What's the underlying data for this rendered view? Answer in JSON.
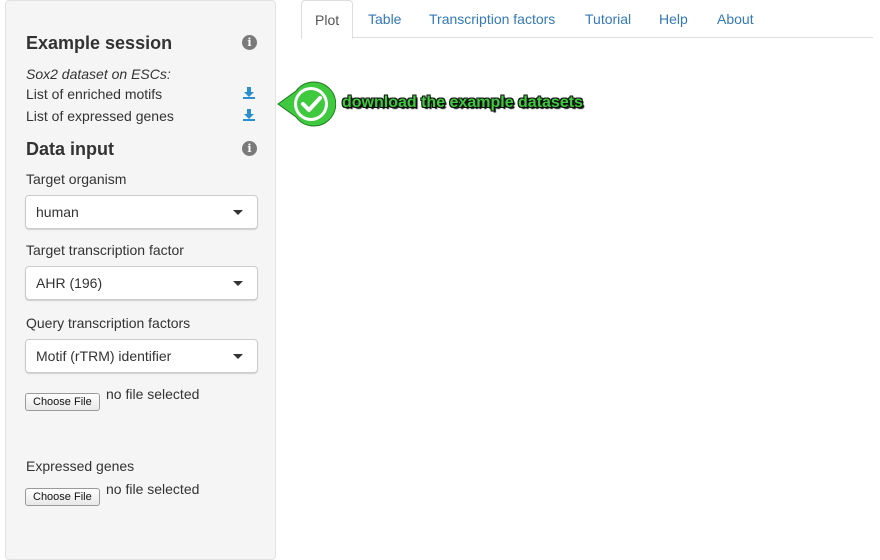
{
  "sidebar": {
    "example": {
      "title": "Example session",
      "subtitle": "Sox2 dataset on ESCs:",
      "links": [
        {
          "label": "List of enriched motifs",
          "icon": "download-icon"
        },
        {
          "label": "List of expressed genes",
          "icon": "download-icon"
        }
      ],
      "info_icon": "info-icon"
    },
    "data_input": {
      "title": "Data input",
      "info_icon": "info-icon",
      "target_organism": {
        "label": "Target organism",
        "value": "human"
      },
      "target_tf": {
        "label": "Target transcription factor",
        "value": "AHR (196)"
      },
      "query_tf": {
        "label": "Query transcription factors",
        "value": "Motif (rTRM) identifier"
      },
      "query_file": {
        "button": "Choose File",
        "status": "no file selected"
      },
      "expressed": {
        "label": "Expressed genes",
        "button": "Choose File",
        "status": "no file selected"
      }
    }
  },
  "tabs": [
    {
      "label": "Plot",
      "active": true
    },
    {
      "label": "Table"
    },
    {
      "label": "Transcription factors"
    },
    {
      "label": "Tutorial"
    },
    {
      "label": "Help"
    },
    {
      "label": "About"
    }
  ],
  "annotation": {
    "text": "download the example datasets",
    "icon": "check-icon",
    "color": "#3ec93e"
  },
  "colors": {
    "link": "#337ab7",
    "sidebar_bg": "#f5f5f5",
    "download_icon": "#2a8fd0"
  }
}
